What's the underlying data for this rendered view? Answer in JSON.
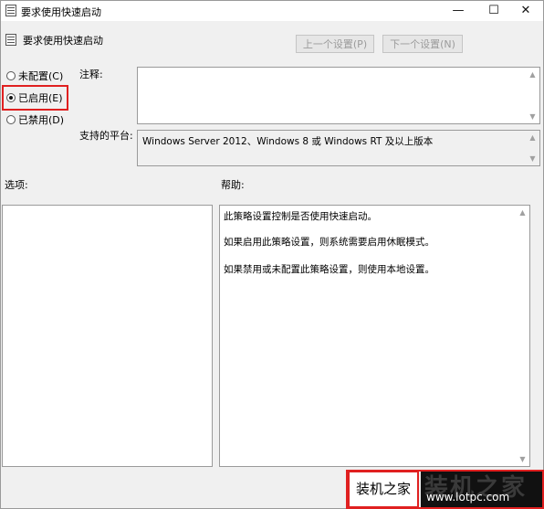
{
  "window": {
    "title": "要求使用快速启动",
    "controls": {
      "minimize": "—",
      "maximize": "☐",
      "close": "✕"
    }
  },
  "header": {
    "setting_title": "要求使用快速启动",
    "prev_button": "上一个设置(P)",
    "next_button": "下一个设置(N)"
  },
  "options": {
    "radios": [
      {
        "label": "未配置(C)",
        "selected": false
      },
      {
        "label": "已启用(E)",
        "selected": true
      },
      {
        "label": "已禁用(D)",
        "selected": false
      }
    ],
    "comment_label": "注释:",
    "comment_value": "",
    "platform_label": "支持的平台:",
    "platform_value": "Windows Server 2012、Windows 8 或 Windows RT 及以上版本"
  },
  "sections": {
    "options_label": "选项:",
    "help_label": "帮助:"
  },
  "help": {
    "lines": [
      "此策略设置控制是否使用快速启动。",
      "如果启用此策略设置，则系统需要启用休眠模式。",
      "如果禁用或未配置此策略设置，则使用本地设置。"
    ]
  },
  "watermark": {
    "text": "装机之家",
    "url": "www.lotpc.com"
  },
  "colors": {
    "highlight": "#e02020",
    "window_bg": "#f0f0f0"
  }
}
